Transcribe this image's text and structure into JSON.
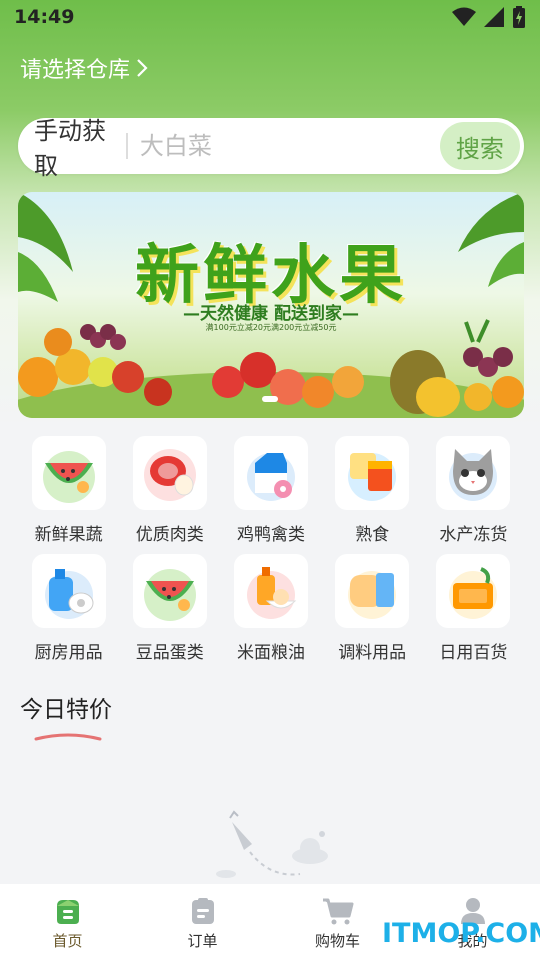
{
  "status_bar": {
    "time": "14:49"
  },
  "header": {
    "warehouse_label": "请选择仓库"
  },
  "search": {
    "mode_label": "手动获取",
    "placeholder": "大白菜",
    "button_label": "搜索"
  },
  "banner": {
    "title": "新鲜水果",
    "subtitle": "—天然健康 配送到家—",
    "promo_text": "满100元立减20元满200元立减50元"
  },
  "categories": [
    {
      "label": "新鲜果蔬",
      "icon": "watermelon-icon"
    },
    {
      "label": "优质肉类",
      "icon": "meat-icon"
    },
    {
      "label": "鸡鸭禽类",
      "icon": "milk-carton-icon"
    },
    {
      "label": "熟食",
      "icon": "cooked-food-icon"
    },
    {
      "label": "水产冻货",
      "icon": "cat-icon"
    },
    {
      "label": "厨房用品",
      "icon": "detergent-icon"
    },
    {
      "label": "豆品蛋类",
      "icon": "watermelon-icon"
    },
    {
      "label": "米面粮油",
      "icon": "rice-oil-icon"
    },
    {
      "label": "调料用品",
      "icon": "bread-icon"
    },
    {
      "label": "日用百货",
      "icon": "basket-icon"
    }
  ],
  "special": {
    "title": "今日特价"
  },
  "tabbar": {
    "items": [
      {
        "label": "首页",
        "icon": "home-icon",
        "active": true
      },
      {
        "label": "订单",
        "icon": "order-icon",
        "active": false
      },
      {
        "label": "购物车",
        "icon": "cart-icon",
        "active": false
      },
      {
        "label": "我的",
        "icon": "user-icon",
        "active": false
      }
    ]
  },
  "watermark": "ITMOP.COM",
  "colors": {
    "brand_green": "#6fbe4a",
    "search_button_bg": "#d4efc5",
    "search_button_text": "#5fa346",
    "watermark": "#1db0e8"
  }
}
